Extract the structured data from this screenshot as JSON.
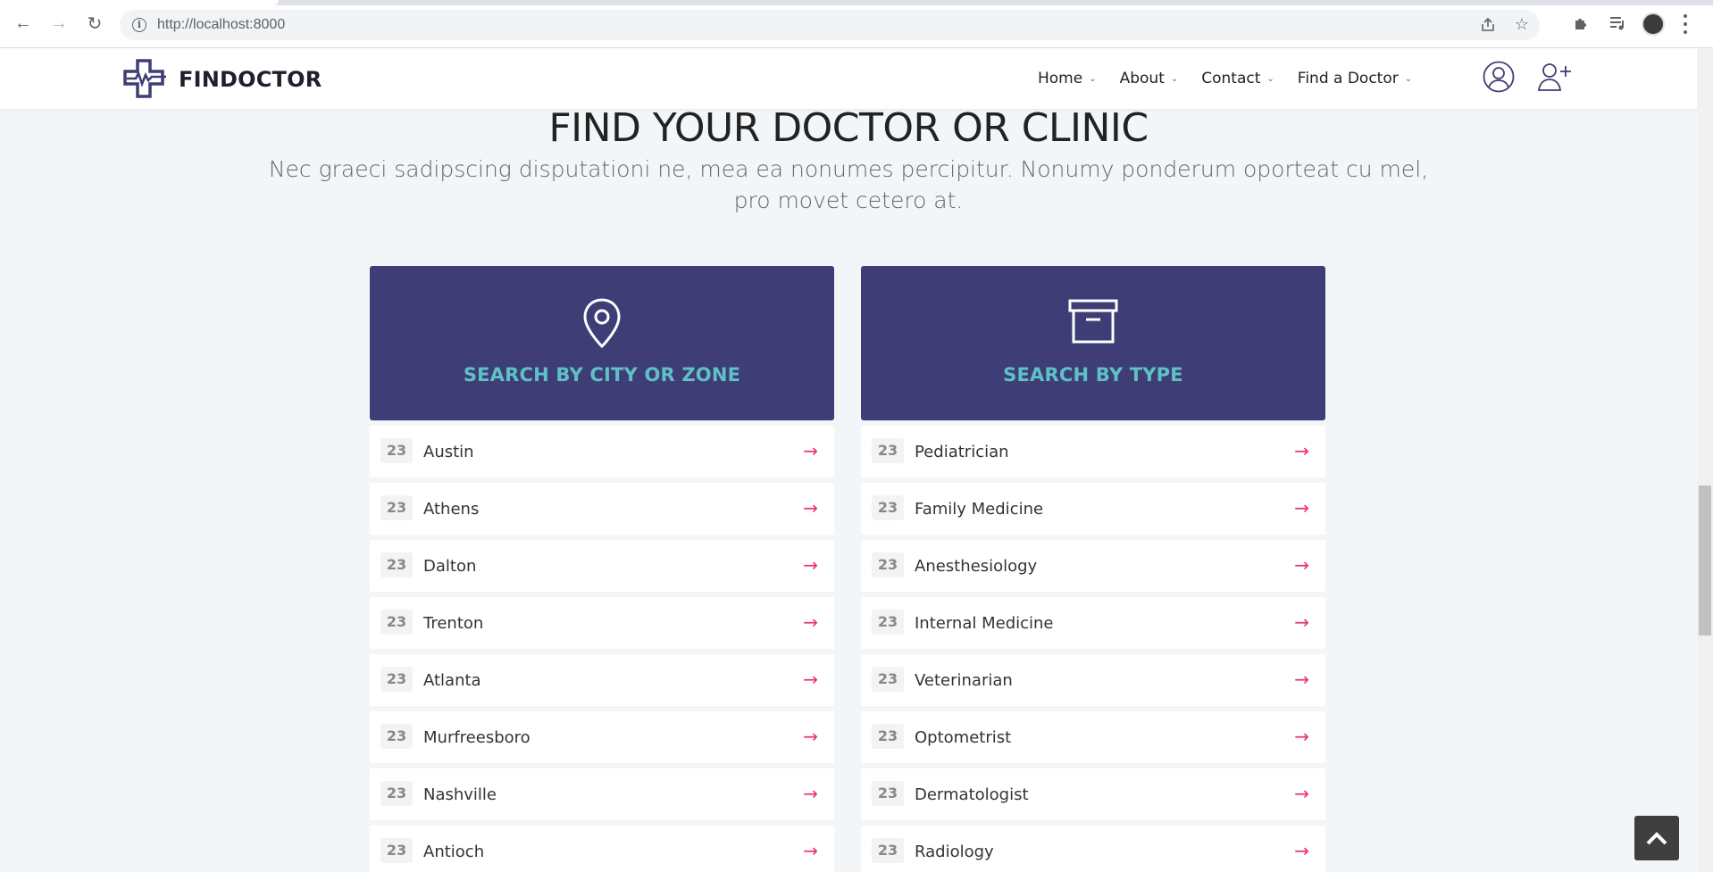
{
  "browser": {
    "url": "http://localhost:8000"
  },
  "site": {
    "brand": "FINDOCTOR",
    "menu": [
      {
        "label": "Home"
      },
      {
        "label": "About"
      },
      {
        "label": "Contact"
      },
      {
        "label": "Find a Doctor"
      }
    ]
  },
  "hero": {
    "title": "FIND YOUR DOCTOR OR CLINIC",
    "subtitle": "Nec graeci sadipscing disputationi ne, mea ea nonumes percipitur. Nonumy ponderum oporteat cu mel, pro movet cetero at."
  },
  "city_search": {
    "title": "SEARCH BY CITY OR ZONE",
    "icon": "map-pin-icon",
    "items": [
      {
        "count": "23",
        "label": "Austin"
      },
      {
        "count": "23",
        "label": "Athens"
      },
      {
        "count": "23",
        "label": "Dalton"
      },
      {
        "count": "23",
        "label": "Trenton"
      },
      {
        "count": "23",
        "label": "Atlanta"
      },
      {
        "count": "23",
        "label": "Murfreesboro"
      },
      {
        "count": "23",
        "label": "Nashville"
      },
      {
        "count": "23",
        "label": "Antioch"
      }
    ]
  },
  "type_search": {
    "title": "SEARCH BY TYPE",
    "icon": "archive-box-icon",
    "items": [
      {
        "count": "23",
        "label": "Pediatrician"
      },
      {
        "count": "23",
        "label": "Family Medicine"
      },
      {
        "count": "23",
        "label": "Anesthesiology"
      },
      {
        "count": "23",
        "label": "Internal Medicine"
      },
      {
        "count": "23",
        "label": "Veterinarian"
      },
      {
        "count": "23",
        "label": "Optometrist"
      },
      {
        "count": "23",
        "label": "Dermatologist"
      },
      {
        "count": "23",
        "label": "Radiology"
      }
    ]
  },
  "colors": {
    "panel": "#3f3d76",
    "panel_title": "#5ec1c6",
    "arrow": "#e7356e",
    "background": "#f3f6f8"
  }
}
